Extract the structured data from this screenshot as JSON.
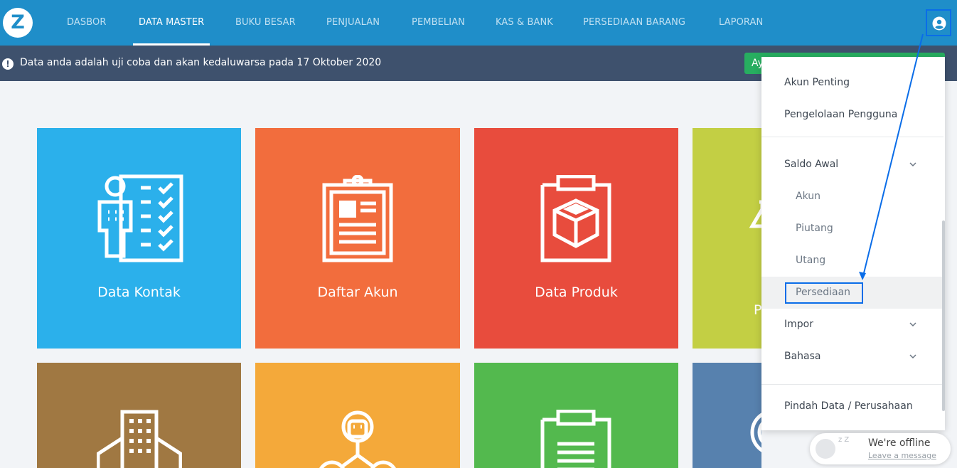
{
  "app": {
    "logo_letter": "Z"
  },
  "nav": {
    "items": [
      {
        "label": "DASBOR"
      },
      {
        "label": "DATA MASTER"
      },
      {
        "label": "BUKU BESAR"
      },
      {
        "label": "PENJUALAN"
      },
      {
        "label": "PEMBELIAN"
      },
      {
        "label": "KAS & BANK"
      },
      {
        "label": "PERSEDIAAN BARANG"
      },
      {
        "label": "LAPORAN"
      }
    ],
    "active": "DATA MASTER",
    "user_icon": "user-circle-icon"
  },
  "alert": {
    "icon": "exclamation-icon",
    "text": "Data anda adalah uji coba dan akan kedaluwarsa pada 17 Oktober 2020",
    "button_label": "Ay"
  },
  "tiles": [
    {
      "label": "Data Kontak",
      "icon": "contact-checklist-icon",
      "color": "#2bb0eb"
    },
    {
      "label": "Daftar Akun",
      "icon": "clipboard-document-icon",
      "color": "#f26d3d"
    },
    {
      "label": "Data Produk",
      "icon": "clipboard-box-icon",
      "color": "#e84c3d"
    },
    {
      "label": "P",
      "icon": "flask-icon",
      "color": "#c3cf44"
    },
    {
      "label": "",
      "icon": "building-icon",
      "color": "#a07842"
    },
    {
      "label": "",
      "icon": "people-network-icon",
      "color": "#f4a93a"
    },
    {
      "label": "",
      "icon": "clipboard-list-icon",
      "color": "#53b94e"
    },
    {
      "label": "",
      "icon": "coins-icon",
      "color": "#5781ae"
    }
  ],
  "dropdown": {
    "items": [
      {
        "label": "Akun Penting"
      },
      {
        "label": "Pengelolaan Pengguna"
      },
      {
        "label": "Saldo Awal",
        "icon": "chevron-down-icon"
      },
      {
        "label": "Akun"
      },
      {
        "label": "Piutang"
      },
      {
        "label": "Utang"
      },
      {
        "label": "Persediaan"
      },
      {
        "label": "Impor",
        "icon": "chevron-down-icon"
      },
      {
        "label": "Bahasa",
        "icon": "chevron-down-icon"
      },
      {
        "label": "Pindah Data / Perusahaan"
      }
    ]
  },
  "chat": {
    "title": "We're offline",
    "link": "Leave a message",
    "sleep_mark": "z Z"
  },
  "colors": {
    "nav_bg": "#1f8ec9",
    "alert_bg": "#3e516d",
    "highlight": "#0a6de8",
    "success": "#27ae60"
  }
}
